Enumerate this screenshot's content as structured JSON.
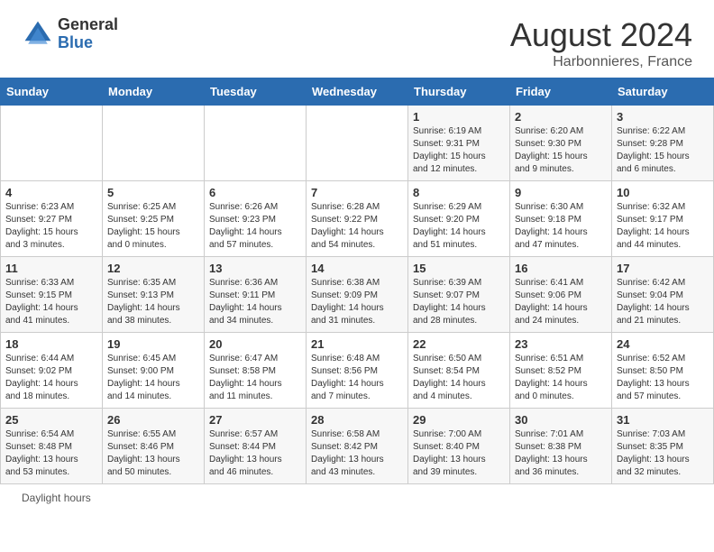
{
  "header": {
    "logo_general": "General",
    "logo_blue": "Blue",
    "title": "August 2024",
    "location": "Harbonnieres, France"
  },
  "days_of_week": [
    "Sunday",
    "Monday",
    "Tuesday",
    "Wednesday",
    "Thursday",
    "Friday",
    "Saturday"
  ],
  "footer": {
    "daylight_label": "Daylight hours"
  },
  "weeks": [
    [
      {
        "day": "",
        "info": ""
      },
      {
        "day": "",
        "info": ""
      },
      {
        "day": "",
        "info": ""
      },
      {
        "day": "",
        "info": ""
      },
      {
        "day": "1",
        "info": "Sunrise: 6:19 AM\nSunset: 9:31 PM\nDaylight: 15 hours\nand 12 minutes."
      },
      {
        "day": "2",
        "info": "Sunrise: 6:20 AM\nSunset: 9:30 PM\nDaylight: 15 hours\nand 9 minutes."
      },
      {
        "day": "3",
        "info": "Sunrise: 6:22 AM\nSunset: 9:28 PM\nDaylight: 15 hours\nand 6 minutes."
      }
    ],
    [
      {
        "day": "4",
        "info": "Sunrise: 6:23 AM\nSunset: 9:27 PM\nDaylight: 15 hours\nand 3 minutes."
      },
      {
        "day": "5",
        "info": "Sunrise: 6:25 AM\nSunset: 9:25 PM\nDaylight: 15 hours\nand 0 minutes."
      },
      {
        "day": "6",
        "info": "Sunrise: 6:26 AM\nSunset: 9:23 PM\nDaylight: 14 hours\nand 57 minutes."
      },
      {
        "day": "7",
        "info": "Sunrise: 6:28 AM\nSunset: 9:22 PM\nDaylight: 14 hours\nand 54 minutes."
      },
      {
        "day": "8",
        "info": "Sunrise: 6:29 AM\nSunset: 9:20 PM\nDaylight: 14 hours\nand 51 minutes."
      },
      {
        "day": "9",
        "info": "Sunrise: 6:30 AM\nSunset: 9:18 PM\nDaylight: 14 hours\nand 47 minutes."
      },
      {
        "day": "10",
        "info": "Sunrise: 6:32 AM\nSunset: 9:17 PM\nDaylight: 14 hours\nand 44 minutes."
      }
    ],
    [
      {
        "day": "11",
        "info": "Sunrise: 6:33 AM\nSunset: 9:15 PM\nDaylight: 14 hours\nand 41 minutes."
      },
      {
        "day": "12",
        "info": "Sunrise: 6:35 AM\nSunset: 9:13 PM\nDaylight: 14 hours\nand 38 minutes."
      },
      {
        "day": "13",
        "info": "Sunrise: 6:36 AM\nSunset: 9:11 PM\nDaylight: 14 hours\nand 34 minutes."
      },
      {
        "day": "14",
        "info": "Sunrise: 6:38 AM\nSunset: 9:09 PM\nDaylight: 14 hours\nand 31 minutes."
      },
      {
        "day": "15",
        "info": "Sunrise: 6:39 AM\nSunset: 9:07 PM\nDaylight: 14 hours\nand 28 minutes."
      },
      {
        "day": "16",
        "info": "Sunrise: 6:41 AM\nSunset: 9:06 PM\nDaylight: 14 hours\nand 24 minutes."
      },
      {
        "day": "17",
        "info": "Sunrise: 6:42 AM\nSunset: 9:04 PM\nDaylight: 14 hours\nand 21 minutes."
      }
    ],
    [
      {
        "day": "18",
        "info": "Sunrise: 6:44 AM\nSunset: 9:02 PM\nDaylight: 14 hours\nand 18 minutes."
      },
      {
        "day": "19",
        "info": "Sunrise: 6:45 AM\nSunset: 9:00 PM\nDaylight: 14 hours\nand 14 minutes."
      },
      {
        "day": "20",
        "info": "Sunrise: 6:47 AM\nSunset: 8:58 PM\nDaylight: 14 hours\nand 11 minutes."
      },
      {
        "day": "21",
        "info": "Sunrise: 6:48 AM\nSunset: 8:56 PM\nDaylight: 14 hours\nand 7 minutes."
      },
      {
        "day": "22",
        "info": "Sunrise: 6:50 AM\nSunset: 8:54 PM\nDaylight: 14 hours\nand 4 minutes."
      },
      {
        "day": "23",
        "info": "Sunrise: 6:51 AM\nSunset: 8:52 PM\nDaylight: 14 hours\nand 0 minutes."
      },
      {
        "day": "24",
        "info": "Sunrise: 6:52 AM\nSunset: 8:50 PM\nDaylight: 13 hours\nand 57 minutes."
      }
    ],
    [
      {
        "day": "25",
        "info": "Sunrise: 6:54 AM\nSunset: 8:48 PM\nDaylight: 13 hours\nand 53 minutes."
      },
      {
        "day": "26",
        "info": "Sunrise: 6:55 AM\nSunset: 8:46 PM\nDaylight: 13 hours\nand 50 minutes."
      },
      {
        "day": "27",
        "info": "Sunrise: 6:57 AM\nSunset: 8:44 PM\nDaylight: 13 hours\nand 46 minutes."
      },
      {
        "day": "28",
        "info": "Sunrise: 6:58 AM\nSunset: 8:42 PM\nDaylight: 13 hours\nand 43 minutes."
      },
      {
        "day": "29",
        "info": "Sunrise: 7:00 AM\nSunset: 8:40 PM\nDaylight: 13 hours\nand 39 minutes."
      },
      {
        "day": "30",
        "info": "Sunrise: 7:01 AM\nSunset: 8:38 PM\nDaylight: 13 hours\nand 36 minutes."
      },
      {
        "day": "31",
        "info": "Sunrise: 7:03 AM\nSunset: 8:35 PM\nDaylight: 13 hours\nand 32 minutes."
      }
    ]
  ]
}
